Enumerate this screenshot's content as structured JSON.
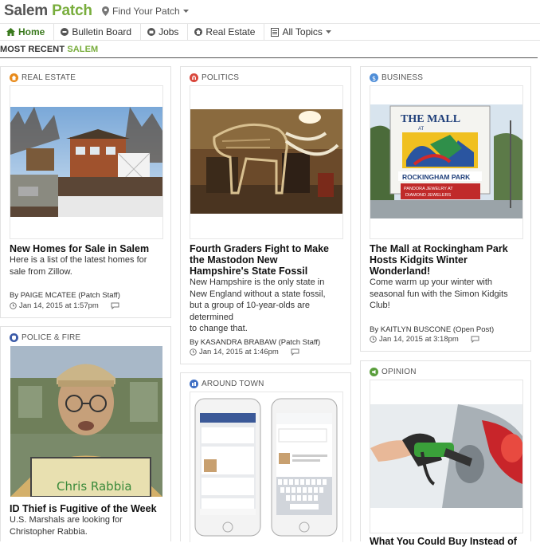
{
  "header": {
    "town": "Salem",
    "brand": "Patch",
    "find_label": "Find Your Patch"
  },
  "nav": {
    "items": [
      {
        "label": "Home"
      },
      {
        "label": "Bulletin Board"
      },
      {
        "label": "Jobs"
      },
      {
        "label": "Real Estate"
      },
      {
        "label": "All Topics"
      }
    ]
  },
  "section": {
    "prefix": "MOST RECENT",
    "town": "SALEM"
  },
  "colors": {
    "brand_green": "#78ad3c",
    "real_estate": "#e88a1a",
    "politics": "#d9463b",
    "business": "#4f8ed8",
    "police_fire": "#3c5ba8",
    "around_town": "#3f6fc4",
    "opinion": "#5a9e3c"
  },
  "cards": [
    {
      "category": "REAL ESTATE",
      "icon": "house-icon",
      "headline": "New Homes for Sale in Salem",
      "summary_lines": [
        "Here is a list of the latest homes for",
        "sale from Zillow."
      ],
      "byline_prefix": "By",
      "author": "PAIGE MCATEE",
      "author_role": "(Patch Staff)",
      "timestamp": "Jan 14, 2015 at 1:57pm"
    },
    {
      "category": "POLITICS",
      "icon": "capitol-icon",
      "headline_lines": [
        "Fourth Graders Fight to Make",
        "the Mastodon New",
        "Hampshire's State Fossil"
      ],
      "summary_lines": [
        "New Hampshire is the only state in",
        "New England without a state fossil,",
        "but a group of 10-year-olds are determined",
        "to change that."
      ],
      "byline_prefix": "By",
      "author": "KASANDRA BRABAW",
      "author_role": "(Patch Staff)",
      "timestamp": "Jan 14, 2015 at 1:46pm"
    },
    {
      "category": "BUSINESS",
      "icon": "dollar-icon",
      "headline_lines": [
        "The Mall at Rockingham Park",
        "Hosts Kidgits Winter",
        "Wonderland!"
      ],
      "summary_lines": [
        "Come warm up your winter with",
        "seasonal fun with the Simon Kidgits",
        "Club!"
      ],
      "byline_prefix": "By",
      "author": "KAITLYN BUSCONE",
      "author_role": "(Open Post)",
      "timestamp": "Jan 14, 2015 at 3:18pm",
      "sign": {
        "the_mall": "THE MALL",
        "at": "AT",
        "rockingham": "ROCKINGHAM PARK",
        "pandora1": "PANDORA JEWELRY AT",
        "pandora2": "DIAMOND JEWELERS"
      }
    },
    {
      "category": "POLICE & FIRE",
      "icon": "badge-icon",
      "headline": "ID Thief is Fugitive of the Week",
      "summary_lines": [
        "U.S. Marshals are looking for",
        "Christopher Rabbia."
      ],
      "placard": "Chris Rabbia"
    },
    {
      "category": "AROUND TOWN",
      "icon": "buildings-icon"
    },
    {
      "category": "OPINION",
      "icon": "megaphone-icon",
      "headline": "What You Could Buy Instead of"
    }
  ]
}
